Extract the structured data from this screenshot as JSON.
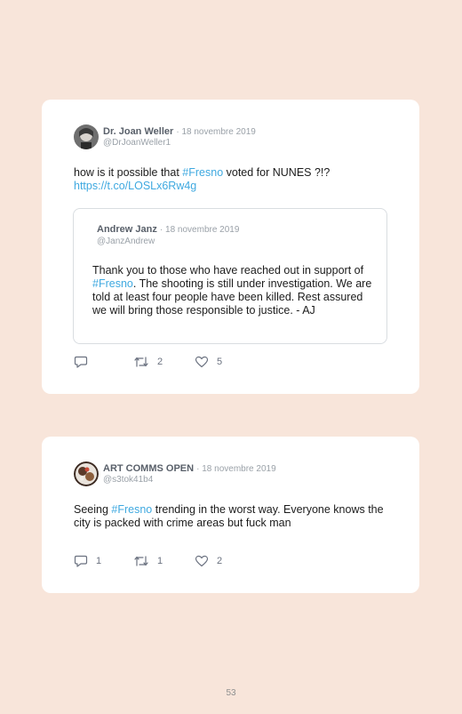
{
  "tweets": [
    {
      "author": "Dr. Joan Weller",
      "date": "· 18 novembre 2019",
      "handle": "@DrJoanWeller1",
      "text_before": "how is it possible that ",
      "hashtag": "#Fresno",
      "text_after": " voted for NUNES ?!?",
      "link": "https://t.co/LOSLx6Rw4g",
      "quoted": {
        "author": "Andrew Janz",
        "date": "· 18 novembre 2019",
        "handle": "@JanzAndrew",
        "text_before": "Thank you to those who have reached out in support of ",
        "hashtag": "#Fresno",
        "text_after": ". The shooting is still under investigation. We are told at least four people have been killed. Rest assured we will bring those responsible to justice. - AJ"
      },
      "reply_count": "",
      "retweet_count": "2",
      "like_count": "5"
    },
    {
      "author": "ART COMMS OPEN",
      "date": "· 18 novembre 2019",
      "handle": "@s3tok41b4",
      "text_before": "Seeing ",
      "hashtag": "#Fresno",
      "text_after": " trending in the worst way. Everyone knows the city is packed with crime areas but fuck man",
      "reply_count": "1",
      "retweet_count": "1",
      "like_count": "2"
    }
  ],
  "icons": {
    "reply": "reply-icon",
    "retweet": "retweet-icon",
    "like": "heart-icon"
  },
  "colors": {
    "background": "#f8e5da",
    "card": "#ffffff",
    "hashtag": "#3fa9e0",
    "name": "#59606a",
    "muted": "#9aa1a8"
  },
  "page_number": "53"
}
